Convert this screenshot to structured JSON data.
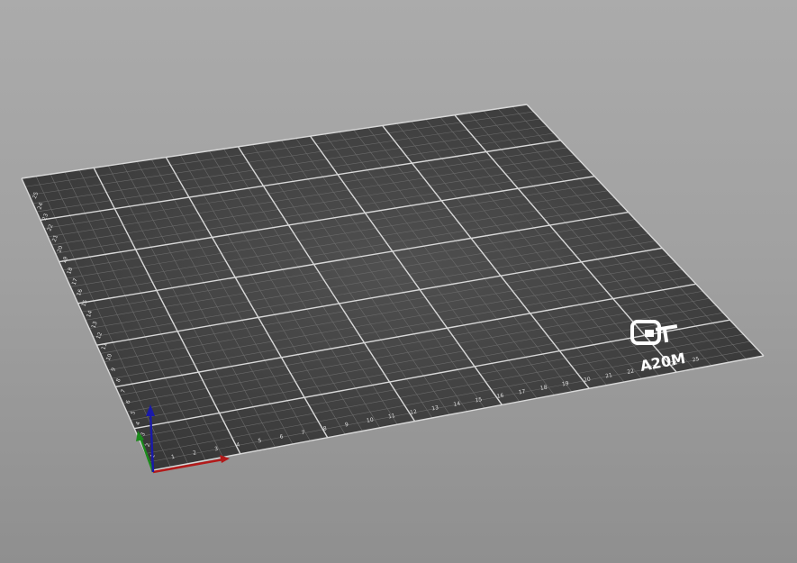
{
  "bed": {
    "brand_logo": "GT",
    "model_label": "A20M",
    "x_ticks": [
      "1",
      "2",
      "3",
      "4",
      "5",
      "6",
      "7",
      "8",
      "9",
      "10",
      "11",
      "12",
      "13",
      "14",
      "15",
      "16",
      "17",
      "18",
      "19",
      "20",
      "21",
      "22",
      "23",
      "24",
      "25"
    ],
    "y_ticks": [
      "1",
      "2",
      "3",
      "4",
      "5",
      "6",
      "7",
      "8",
      "9",
      "10",
      "11",
      "12",
      "13",
      "14",
      "15",
      "16",
      "17",
      "18",
      "19",
      "20",
      "21",
      "22",
      "23",
      "24",
      "25"
    ],
    "colors": {
      "background": "#a6a6a6",
      "plate": "#3e3e3e",
      "grid_minor": "#6a6a6a",
      "grid_major": "#d8d8d8",
      "axis_x": "#b21a1a",
      "axis_y": "#1c8a1c",
      "axis_z": "#1a1aa8"
    }
  },
  "axes_gizmo": {
    "x": "x-axis",
    "y": "y-axis",
    "z": "z-axis"
  }
}
